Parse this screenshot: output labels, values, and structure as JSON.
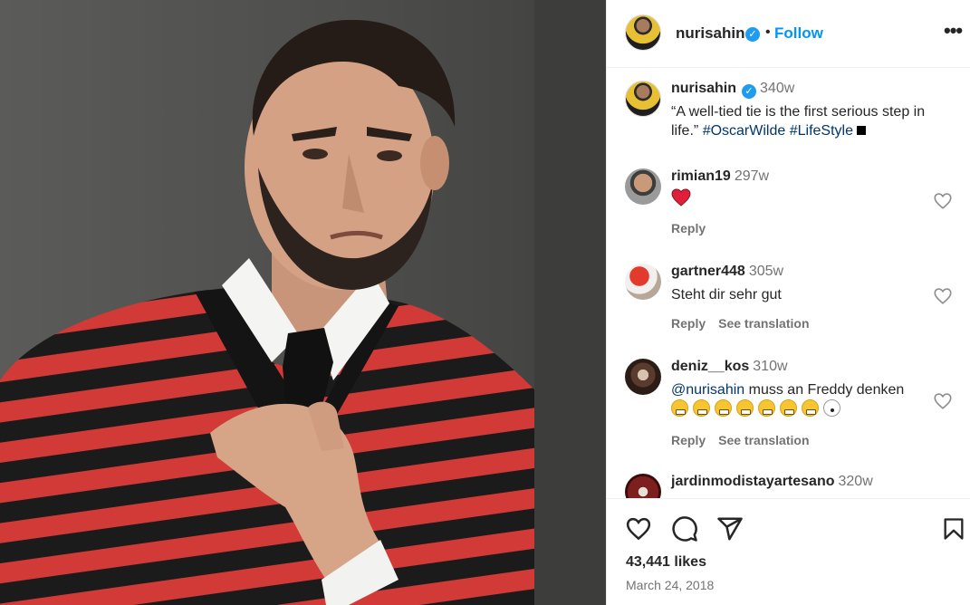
{
  "post": {
    "author": "nurisahin",
    "follow_label": "Follow",
    "dot": "•",
    "more_label": "•••",
    "caption": {
      "username": "nurisahin",
      "age": "340w",
      "text": "“A well-tied tie is the first serious step in life.”",
      "hashtags": [
        "#OscarWilde",
        "#LifeStyle"
      ]
    },
    "likes": "43,441 likes",
    "date": "March 24, 2018"
  },
  "comments": [
    {
      "username": "rimian19",
      "age": "297w",
      "text": "",
      "emoji": "red-heart",
      "reply_label": "Reply"
    },
    {
      "username": "gartner448",
      "age": "305w",
      "text": "Steht dir sehr gut",
      "reply_label": "Reply",
      "translate_label": "See translation"
    },
    {
      "username": "deniz__kos",
      "age": "310w",
      "mention": "@nurisahin",
      "text": "muss an Freddy denken",
      "reply_label": "Reply",
      "translate_label": "See translation"
    },
    {
      "username": "jardinmodistayartesano",
      "age": "320w"
    }
  ],
  "colors": {
    "link": "#0095f6",
    "hashtag": "#00376b",
    "muted": "#737373",
    "verified": "#1f9bf0"
  }
}
